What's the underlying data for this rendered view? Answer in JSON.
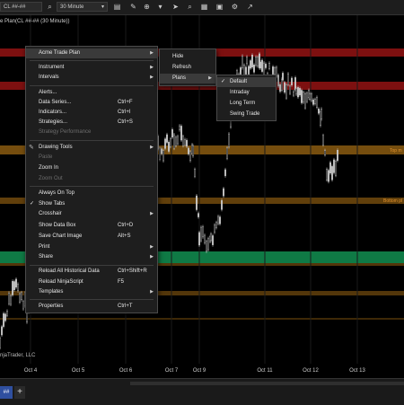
{
  "toolbar": {
    "instrument": "CL ##-##",
    "interval": "30 Minute",
    "icons": [
      "search-icon",
      "chevron-down-icon",
      "bar-chart-icon",
      "pencil-icon",
      "crosshair-icon",
      "cursor-icon",
      "zoom-icon",
      "properties-icon",
      "data-box-icon",
      "settings-icon",
      "expand-icon"
    ]
  },
  "chart": {
    "title": "e Plan(CL ##-## (30 Minute))",
    "copyright": "njaTrader, LLC",
    "x_labels": [
      "Oct 4",
      "Oct 5",
      "Oct 6",
      "Oct 7",
      "Oct 9",
      "Oct 11",
      "Oct 12",
      "Oct 13"
    ],
    "zones": {
      "top_label": "Top m",
      "bottom_label": "Bottom pl"
    },
    "colors": {
      "red": "#8b1212",
      "orange": "#8a5a10",
      "green": "#0f7a45",
      "candle": "#c8c8c8"
    }
  },
  "tabbar": {
    "tab_label": "##",
    "add_label": "+"
  },
  "context_menu": {
    "header": "Acme Trade Plan",
    "instrument": "Instrument",
    "intervals": "Intervals",
    "alerts": "Alerts...",
    "data_series": "Data Series...",
    "data_series_sc": "Ctrl+F",
    "indicators": "Indicators...",
    "indicators_sc": "Ctrl+I",
    "strategies": "Strategies...",
    "strategies_sc": "Ctrl+S",
    "strategy_performance": "Strategy Performance",
    "drawing_tools": "Drawing Tools",
    "paste": "Paste",
    "zoom_in": "Zoom In",
    "zoom_out": "Zoom Out",
    "always_on_top": "Always On Top",
    "show_tabs": "Show Tabs",
    "crosshair": "Crosshair",
    "show_data_box": "Show Data Box",
    "show_data_box_sc": "Ctrl+D",
    "save_chart_image": "Save Chart Image",
    "save_chart_image_sc": "Alt+S",
    "print": "Print",
    "share": "Share",
    "reload_historical": "Reload All Historical Data",
    "reload_historical_sc": "Ctrl+Shift+R",
    "reload_ninjascript": "Reload NinjaScript",
    "reload_ninjascript_sc": "F5",
    "templates": "Templates",
    "properties": "Properties",
    "properties_sc": "Ctrl+T"
  },
  "submenu_plan": {
    "hide": "Hide",
    "refresh": "Refresh",
    "plans": "Plans"
  },
  "submenu_plans": {
    "default": "Default",
    "intraday": "Intraday",
    "long_term": "Long Term",
    "swing_trade": "Swing Trade"
  }
}
